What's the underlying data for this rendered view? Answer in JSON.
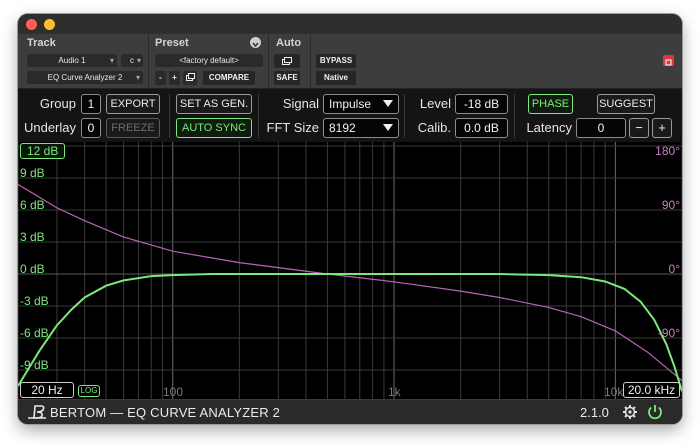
{
  "host": {
    "track_label": "Track",
    "preset_label": "Preset",
    "auto_label": "Auto",
    "track_name": "Audio 1",
    "track_channel": "c",
    "insert_name": "EQ Curve Analyzer 2",
    "preset_value": "<factory default>",
    "minus": "-",
    "plus": "+",
    "compare": "COMPARE",
    "safe": "SAFE",
    "bypass": "BYPASS",
    "native": "Native"
  },
  "controls": {
    "group_label": "Group",
    "group_value": "1",
    "export": "EXPORT",
    "underlay_label": "Underlay",
    "underlay_value": "0",
    "freeze": "FREEZE",
    "set_as_gen": "SET AS GEN.",
    "auto_sync": "AUTO SYNC",
    "signal_label": "Signal",
    "signal_value": "Impulse",
    "fft_label": "FFT Size",
    "fft_value": "8192",
    "level_label": "Level",
    "level_value": "-18 dB",
    "calib_label": "Calib.",
    "calib_value": "0.0 dB",
    "phase": "PHASE",
    "suggest": "SUGGEST",
    "latency_label": "Latency",
    "latency_value": "0",
    "latency_minus": "−",
    "latency_plus": "+"
  },
  "graph": {
    "range_db": "12 dB",
    "db_labels": [
      "9 dB",
      "6 dB",
      "3 dB",
      "0 dB",
      "-3 dB",
      "-6 dB",
      "-9 dB"
    ],
    "deg_labels": [
      "180°",
      "90°",
      "0°",
      "-90°"
    ],
    "freq_labels": [
      "100",
      "1k",
      "10k"
    ],
    "min_freq": "20 Hz",
    "log_badge": "LOG",
    "max_freq": "20.0 kHz"
  },
  "chart_data": {
    "type": "line",
    "x_scale": "log",
    "xlim": [
      20,
      20000
    ],
    "ylim_db": [
      -12,
      12
    ],
    "ylim_deg": [
      -180,
      180
    ],
    "series": [
      {
        "axis": "db",
        "color": "#7be87b",
        "x": [
          20,
          25,
          30,
          35,
          40,
          50,
          60,
          80,
          100,
          150,
          200,
          300,
          500,
          1000,
          2000,
          3000,
          5000,
          7000,
          9000,
          11000,
          13000,
          15000,
          17000,
          18500,
          20000
        ],
        "values": [
          -10.5,
          -7.2,
          -4.8,
          -3.3,
          -2.2,
          -1.1,
          -0.6,
          -0.2,
          -0.1,
          0,
          0,
          0,
          0,
          0,
          0,
          0,
          -0.1,
          -0.3,
          -0.7,
          -1.4,
          -2.6,
          -4.3,
          -6.6,
          -8.7,
          -11.0
        ]
      },
      {
        "axis": "deg",
        "color": "#b565b5",
        "x": [
          20,
          30,
          40,
          60,
          100,
          200,
          300,
          500,
          1000,
          2000,
          3000,
          5000,
          7000,
          10000,
          14000,
          20000
        ],
        "values": [
          126,
          93,
          75,
          52,
          32,
          16,
          9,
          0,
          -11,
          -24,
          -33,
          -47,
          -60,
          -80,
          -110,
          -150
        ]
      }
    ]
  },
  "footer": {
    "logo_text": "BERTOM — EQ CURVE ANALYZER 2",
    "version": "2.1.0"
  },
  "colors": {
    "accent_green": "#7be87b",
    "phase_purple": "#b565b5",
    "background": "#000000"
  }
}
